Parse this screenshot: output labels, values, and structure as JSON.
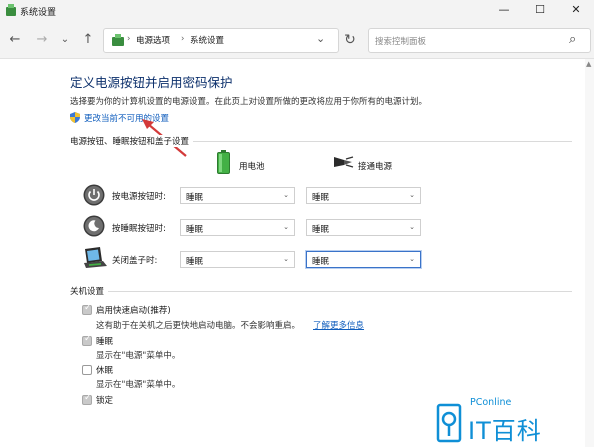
{
  "window": {
    "title": "系统设置",
    "controls": {
      "minimize": "—",
      "maximize": "☐",
      "close": "✕"
    }
  },
  "nav": {
    "back": "←",
    "forward": "→",
    "recent": "⌄",
    "up": "↑",
    "breadcrumb": [
      "电源选项",
      "系统设置"
    ],
    "separators": [
      "›",
      "›"
    ],
    "leading_separator": "›",
    "dropdown": "⌄",
    "refresh": "↻",
    "search_placeholder": "搜索控制面板",
    "search_icon": "⌕"
  },
  "main": {
    "heading": "定义电源按钮并启用密码保护",
    "description": "选择要为你的计算机设置的电源设置。在此页上对设置所做的更改将应用于你所有的电源计划。",
    "change_link": "更改当前不可用的设置",
    "buttons_section": {
      "title": "电源按钮、睡眠按钮和盖子设置",
      "col_battery": "用电池",
      "col_plugged": "接通电源",
      "rows": [
        {
          "label": "按电源按钮时:",
          "battery": "睡眠",
          "plugged": "睡眠",
          "icon": "power-icon"
        },
        {
          "label": "按睡眠按钮时:",
          "battery": "睡眠",
          "plugged": "睡眠",
          "icon": "sleep-icon"
        },
        {
          "label": "关闭盖子时:",
          "battery": "睡眠",
          "plugged": "睡眠",
          "icon": "laptop-lid-icon"
        }
      ]
    },
    "shutdown_section": {
      "title": "关机设置",
      "items": [
        {
          "label": "启用快速启动(推荐)",
          "desc": "这有助于在关机之后更快地启动电脑。不会影响重启。",
          "link": "了解更多信息",
          "checked": true
        },
        {
          "label": "睡眠",
          "desc": "显示在\"电源\"菜单中。",
          "checked": true
        },
        {
          "label": "休眠",
          "desc": "显示在\"电源\"菜单中。",
          "checked": false
        },
        {
          "label": "锁定",
          "desc": "",
          "checked": true
        }
      ]
    }
  },
  "watermark": {
    "brand": "PConline",
    "name": "IT百科"
  },
  "colors": {
    "heading": "#0b2f6b",
    "link": "#0f5dbd",
    "arrow": "#d33a3a",
    "battery": "#39a83a",
    "watermark": "#0f8fd6"
  }
}
